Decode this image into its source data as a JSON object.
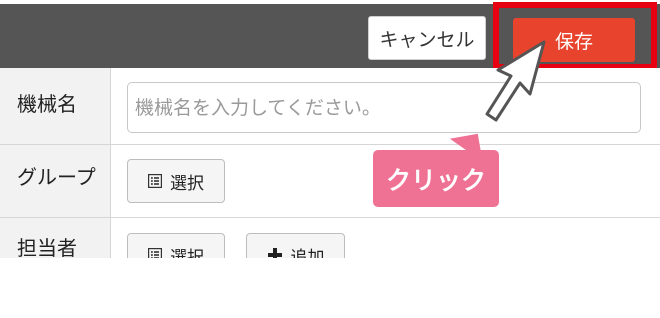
{
  "header": {
    "cancel_label": "キャンセル",
    "save_label": "保存"
  },
  "form": {
    "machine_name": {
      "label": "機械名",
      "placeholder": "機械名を入力してください。",
      "value": ""
    },
    "group": {
      "label": "グループ",
      "select_label": "選択"
    },
    "assignee": {
      "label": "担当者",
      "select_label": "選択",
      "add_label": "追加"
    }
  },
  "annotation": {
    "callout_text": "クリック"
  },
  "colors": {
    "header_bg": "#555555",
    "save_bg": "#e8432c",
    "highlight_border": "#e60012",
    "callout_bg": "#ef7193"
  },
  "icons": {
    "select": "list-icon",
    "add": "plus-icon",
    "pointer": "cursor-arrow-icon"
  }
}
